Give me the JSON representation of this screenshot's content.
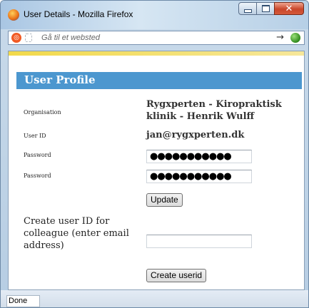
{
  "window": {
    "title": "User Details - Mozilla Firefox",
    "close_glyph": "✕"
  },
  "urlbar": {
    "placeholder": "Gå til et websted",
    "go_glyph": "→"
  },
  "form": {
    "heading": "User Profile",
    "organisation_label": "Organisation",
    "organisation_line1": "Rygxperten - Kiropraktisk",
    "organisation_line2": "klinik - Henrik Wulff",
    "userid_label": "User ID",
    "userid_value": "jan@rygxperten.dk",
    "password_label": "Password",
    "password_value": "●●●●●●●●●●●",
    "password2_label": "Password",
    "password2_value": "●●●●●●●●●●●",
    "update_label": "Update",
    "colleague_label": "Create user ID for colleague (enter email address)",
    "colleague_value": "",
    "create_label": "Create userid"
  },
  "status": {
    "text": "Done"
  },
  "colors": {
    "header": "#4c97cf",
    "titlebar": "#b6cde3",
    "close": "#c9462a"
  },
  "icons": [
    "firefox-icon",
    "minimize-icon",
    "maximize-icon",
    "close-icon",
    "site-icon",
    "page-icon",
    "go-arrow-icon",
    "globe-icon"
  ]
}
